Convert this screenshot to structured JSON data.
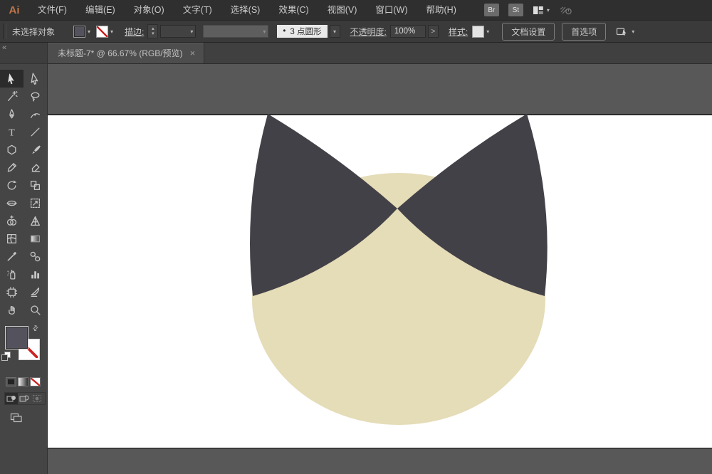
{
  "app": {
    "logo_text": "Ai"
  },
  "menubar": {
    "items": [
      {
        "name": "file",
        "label": "文件(F)"
      },
      {
        "name": "edit",
        "label": "编辑(E)"
      },
      {
        "name": "object",
        "label": "对象(O)"
      },
      {
        "name": "type",
        "label": "文字(T)"
      },
      {
        "name": "select",
        "label": "选择(S)"
      },
      {
        "name": "effect",
        "label": "效果(C)"
      },
      {
        "name": "view",
        "label": "视图(V)"
      },
      {
        "name": "window",
        "label": "窗口(W)"
      },
      {
        "name": "help",
        "label": "帮助(H)"
      }
    ],
    "bridge_label": "Br",
    "stock_label": "St"
  },
  "controlbar": {
    "status_text": "未选择对象",
    "stroke_label": "描边:",
    "brush_bullet": "•",
    "brush_name": "3 点圆形",
    "opacity_label": "不透明度:",
    "opacity_value": "100%",
    "expand_arrow": ">",
    "style_label": "样式:",
    "document_setup_label": "文档设置",
    "preferences_label": "首选项"
  },
  "tabbar": {
    "active_tab_title": "未标题-7* @ 66.67% (RGB/预览)",
    "close_glyph": "×"
  },
  "toolbar": {
    "collapse_glyph": "«",
    "tools": [
      "selection",
      "direct-selection",
      "magic-wand",
      "lasso",
      "pen",
      "curvature",
      "type",
      "line-segment",
      "polygon",
      "paintbrush",
      "pencil",
      "eraser",
      "rotate",
      "scale",
      "width",
      "free-transform",
      "shape-builder",
      "perspective-grid",
      "mesh",
      "gradient",
      "eyedropper",
      "blend",
      "symbol-sprayer",
      "column-graph",
      "artboard",
      "slice",
      "hand",
      "zoom"
    ],
    "active_tool": "selection"
  },
  "icons": {
    "chevron_down": "▾",
    "spinner_up": "▴",
    "spinner_down": "▾",
    "swap": "⇄"
  },
  "artwork": {
    "description": "cat head: cream ellipse with two dark curved-triangle ears",
    "head_fill": "#e5dcb8",
    "ear_fill": "#434148"
  },
  "colors": {
    "menubar_bg": "#2f2f2f",
    "controlbar_bg": "#3a3a3a",
    "tabbar_bg": "#404040",
    "active_tab_bg": "#4d4d4d",
    "pasteboard": "#585858",
    "toolbar_bg": "#454545",
    "fill_swatch": "#54525c",
    "artboard": "#ffffff",
    "none_red": "#cf2222"
  }
}
